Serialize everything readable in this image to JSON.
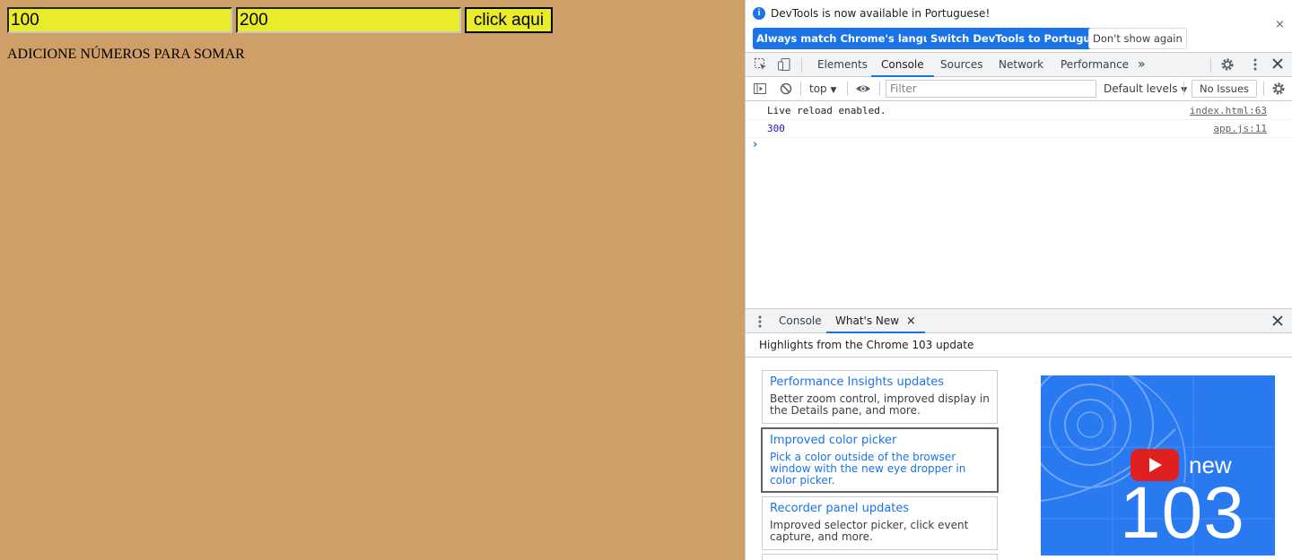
{
  "page": {
    "input1_value": "100",
    "input2_value": "200",
    "button_label": "click aqui",
    "instruction_text": "ADICIONE NÚMEROS PARA SOMAR"
  },
  "devtools": {
    "infobar": {
      "message": "DevTools is now available in Portuguese!",
      "btn_match": "Always match Chrome's language",
      "btn_switch": "Switch DevTools to Portuguese",
      "btn_dismiss": "Don't show again",
      "close": "×"
    },
    "tabs": [
      "Elements",
      "Console",
      "Sources",
      "Network",
      "Performance"
    ],
    "tabs_more": "»",
    "console_toolbar": {
      "context": "top",
      "filter_placeholder": "Filter",
      "levels": "Default levels",
      "issues": "No Issues"
    },
    "messages": [
      {
        "text": "Live reload enabled.",
        "source": "index.html:63"
      },
      {
        "text": "300",
        "source": "app.js:11"
      }
    ],
    "prompt": "›",
    "drawer": {
      "tabs": [
        "Console",
        "What's New"
      ],
      "close_tab": "×",
      "highlights": "Highlights from the Chrome 103 update"
    },
    "whats_new_cards": [
      {
        "title": "Performance Insights updates",
        "desc": "Better zoom control, improved display in the Details pane, and more."
      },
      {
        "title": "Improved color picker",
        "desc": "Pick a color outside of the browser window with the new eye dropper in color picker."
      },
      {
        "title": "Recorder panel updates",
        "desc": "Improved selector picker, click event capture, and more."
      }
    ],
    "video": {
      "word": "new",
      "version": "103"
    }
  },
  "colors": {
    "page_bg": "#cf9f68",
    "input_bg": "#e9ec2a",
    "accent": "#1a73e8",
    "video_bg": "#2979f0"
  }
}
